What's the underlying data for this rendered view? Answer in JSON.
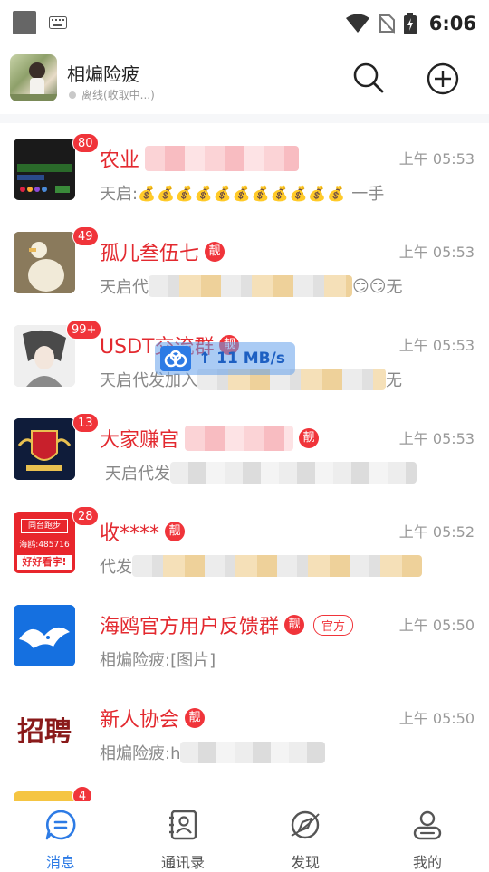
{
  "status_bar": {
    "time": "6:06"
  },
  "header": {
    "account_name": "相煸险疲",
    "status_text": "离线(收取中...)"
  },
  "colors": {
    "accent": "#2d7be5",
    "unread_badge": "#f0343a",
    "title_red": "#e3292f"
  },
  "conversations": [
    {
      "title": "农业",
      "unread": "80",
      "time": "上午 05:53",
      "preview_prefix": "天启:",
      "preview_suffix": "一手",
      "coin_count": 11,
      "liang": "",
      "official": ""
    },
    {
      "title": "孤儿叁伍七",
      "unread": "49",
      "time": "上午 05:53",
      "preview_prefix": "天启代",
      "preview_suffix": "无",
      "liang": "靓",
      "official": ""
    },
    {
      "title": "USDT交流群",
      "unread": "99+",
      "time": "上午 05:53",
      "preview_prefix": "天启代发加入",
      "preview_suffix": "无",
      "liang": "靓",
      "official": ""
    },
    {
      "title": "大家赚官",
      "unread": "13",
      "time": "上午 05:53",
      "preview_prefix": "天启代发",
      "preview_suffix": "",
      "liang": "靓",
      "official": ""
    },
    {
      "title": "收****",
      "unread": "28",
      "time": "上午 05:52",
      "preview_prefix": "代发",
      "preview_suffix": "",
      "liang": "靓",
      "official": ""
    },
    {
      "title": "海鸥官方用户反馈群",
      "unread": "",
      "time": "上午 05:50",
      "preview_prefix": "相煸险疲:[图片]",
      "preview_suffix": "",
      "liang": "靓",
      "official": "官方"
    },
    {
      "title": "新人协会",
      "unread": "",
      "time": "上午 05:50",
      "preview_prefix": "相煸险疲:h",
      "preview_suffix": "",
      "liang": "靓",
      "official": ""
    },
    {
      "title": "",
      "unread": "4",
      "time": "",
      "preview_prefix": "",
      "preview_suffix": "",
      "liang": "",
      "official": ""
    }
  ],
  "avatar_texts": {
    "row5_line1": "同台跑步",
    "row5_line2": "海鸥:485716",
    "row5_line3": "好好看字!",
    "row7_text": "招聘"
  },
  "speed_widget": {
    "text": "↑ 11 MB/s"
  },
  "bottom_nav": [
    {
      "label": "消息",
      "icon": "message-icon",
      "active": true
    },
    {
      "label": "通讯录",
      "icon": "contacts-icon",
      "active": false
    },
    {
      "label": "发现",
      "icon": "discover-icon",
      "active": false
    },
    {
      "label": "我的",
      "icon": "profile-icon",
      "active": false
    }
  ]
}
